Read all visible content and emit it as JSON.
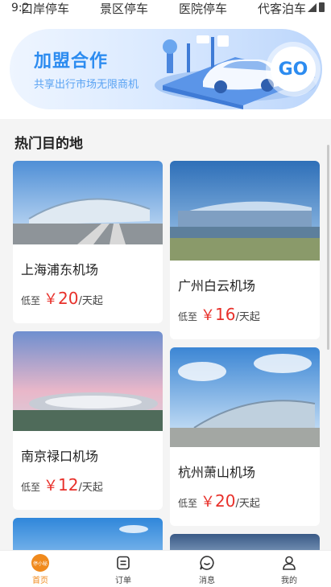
{
  "status_bar": {
    "time": "9:2"
  },
  "categories": [
    {
      "label": "口岸停车"
    },
    {
      "label": "景区停车"
    },
    {
      "label": "医院停车"
    },
    {
      "label": "代客泊车"
    }
  ],
  "banner": {
    "title": "加盟合作",
    "subtitle": "共享出行市场无限商机",
    "go_label": "GO"
  },
  "section": {
    "title": "热门目的地"
  },
  "destinations": [
    {
      "name": "上海浦东机场",
      "prefix": "低至",
      "currency": "￥",
      "price": "20",
      "unit": "/天起"
    },
    {
      "name": "广州白云机场",
      "prefix": "低至",
      "currency": "￥",
      "price": "16",
      "unit": "/天起"
    },
    {
      "name": "南京禄口机场",
      "prefix": "低至",
      "currency": "￥",
      "price": "12",
      "unit": "/天起"
    },
    {
      "name": "杭州萧山机场",
      "prefix": "低至",
      "currency": "￥",
      "price": "20",
      "unit": "/天起"
    }
  ],
  "tabs": [
    {
      "label": "首页",
      "badge": "停小秘",
      "icon": "home-icon",
      "active": true
    },
    {
      "label": "订单",
      "icon": "order-icon"
    },
    {
      "label": "消息",
      "icon": "message-icon"
    },
    {
      "label": "我的",
      "icon": "profile-icon"
    }
  ],
  "colors": {
    "accent": "#2d8cf0",
    "price": "#e8302a",
    "active_tab": "#f08a1d"
  }
}
